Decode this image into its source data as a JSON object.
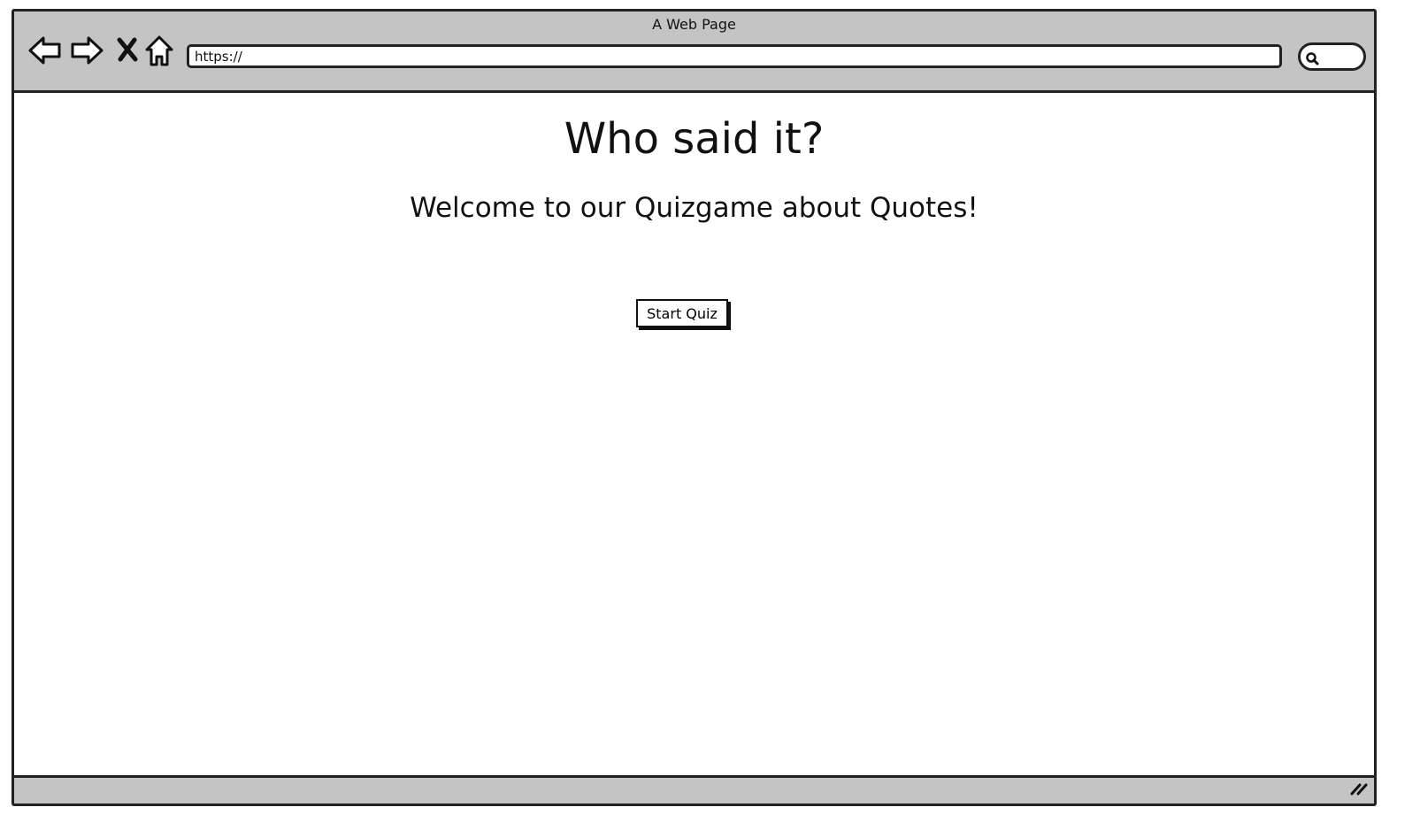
{
  "window": {
    "title": "A Web Page",
    "url": "https://"
  },
  "toolbar": {
    "icons": [
      "back-arrow-icon",
      "forward-arrow-icon",
      "stop-icon",
      "home-icon",
      "search-icon"
    ]
  },
  "page": {
    "heading": "Who said it?",
    "subheading": "Welcome to our Quizgame about Quotes!",
    "start_button_label": "Start Quiz"
  }
}
